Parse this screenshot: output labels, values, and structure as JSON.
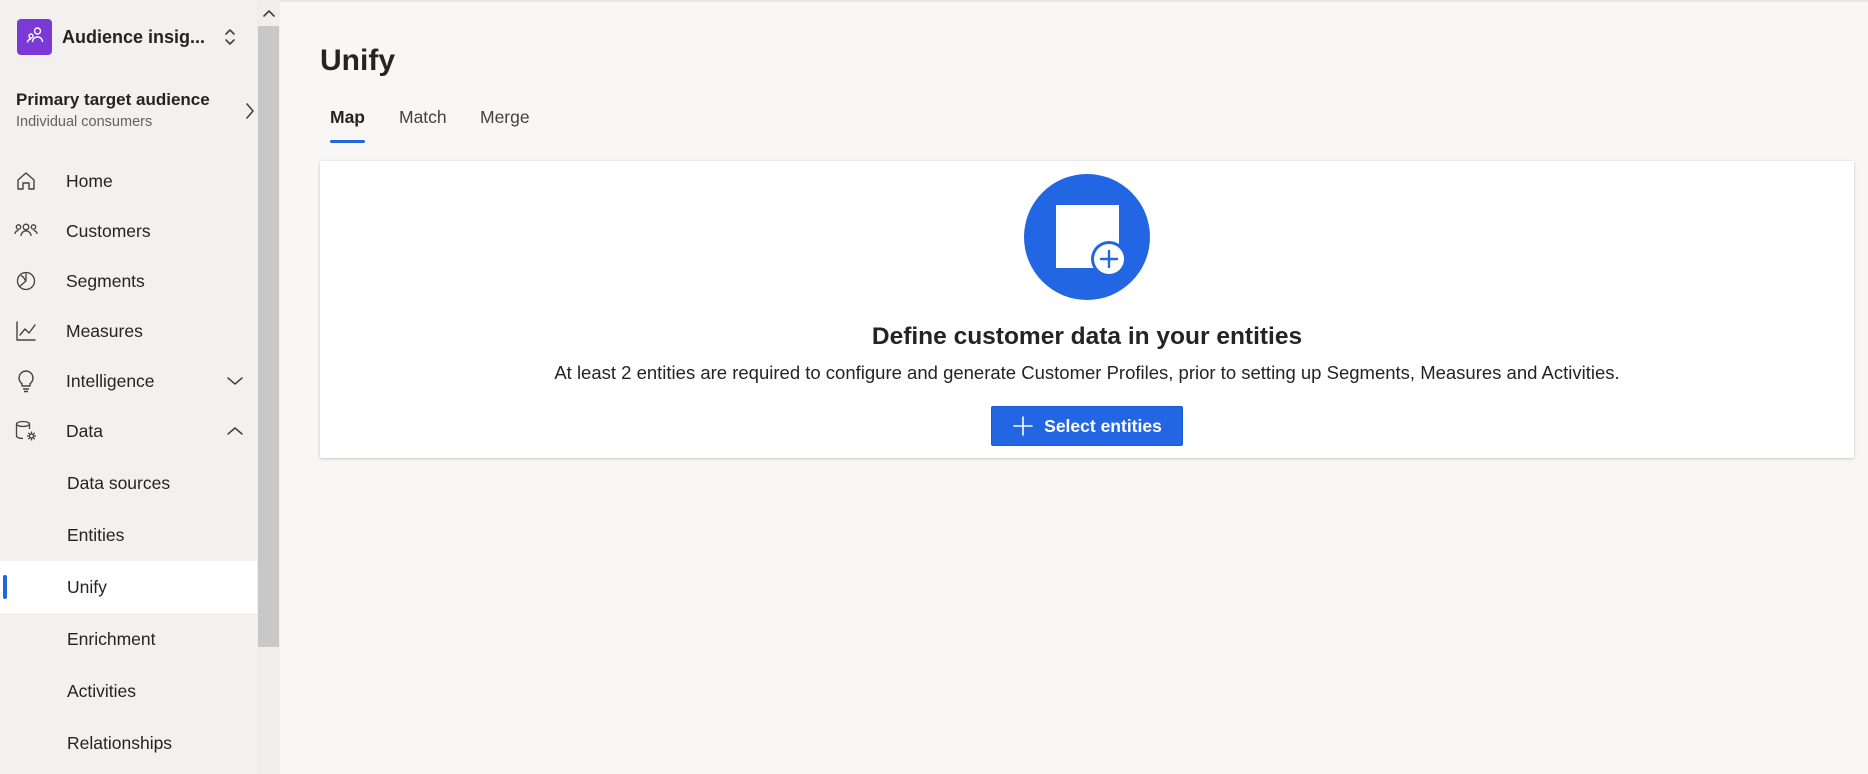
{
  "app": {
    "name": "Audience insig...",
    "logo_icon": "people-icon",
    "switcher_icon": "chevron-up-down-icon",
    "accent_color": "#7b39d6"
  },
  "audience": {
    "title": "Primary target audience",
    "subtitle": "Individual consumers"
  },
  "nav": {
    "items": [
      {
        "label": "Home",
        "icon": "home-icon"
      },
      {
        "label": "Customers",
        "icon": "people-icon"
      },
      {
        "label": "Segments",
        "icon": "segments-icon"
      },
      {
        "label": "Measures",
        "icon": "chart-line-icon"
      },
      {
        "label": "Intelligence",
        "icon": "lightbulb-icon",
        "expanded": false
      },
      {
        "label": "Data",
        "icon": "database-gear-icon",
        "expanded": true
      }
    ],
    "data_subitems": [
      {
        "label": "Data sources"
      },
      {
        "label": "Entities"
      },
      {
        "label": "Unify",
        "selected": true
      },
      {
        "label": "Enrichment"
      },
      {
        "label": "Activities"
      },
      {
        "label": "Relationships"
      }
    ]
  },
  "main": {
    "title": "Unify",
    "tabs": [
      {
        "label": "Map",
        "selected": true
      },
      {
        "label": "Match"
      },
      {
        "label": "Merge"
      }
    ],
    "empty_state": {
      "heading": "Define customer data in your entities",
      "description": "At least 2 entities are required to configure and generate Customer Profiles, prior to setting up Segments, Measures and Activities.",
      "button_label": "Select entities",
      "button_icon": "plus-icon"
    }
  },
  "colors": {
    "primary": "#2266e3",
    "sidebar_bg": "#f2f1f0",
    "page_bg": "#f8f7f6"
  }
}
